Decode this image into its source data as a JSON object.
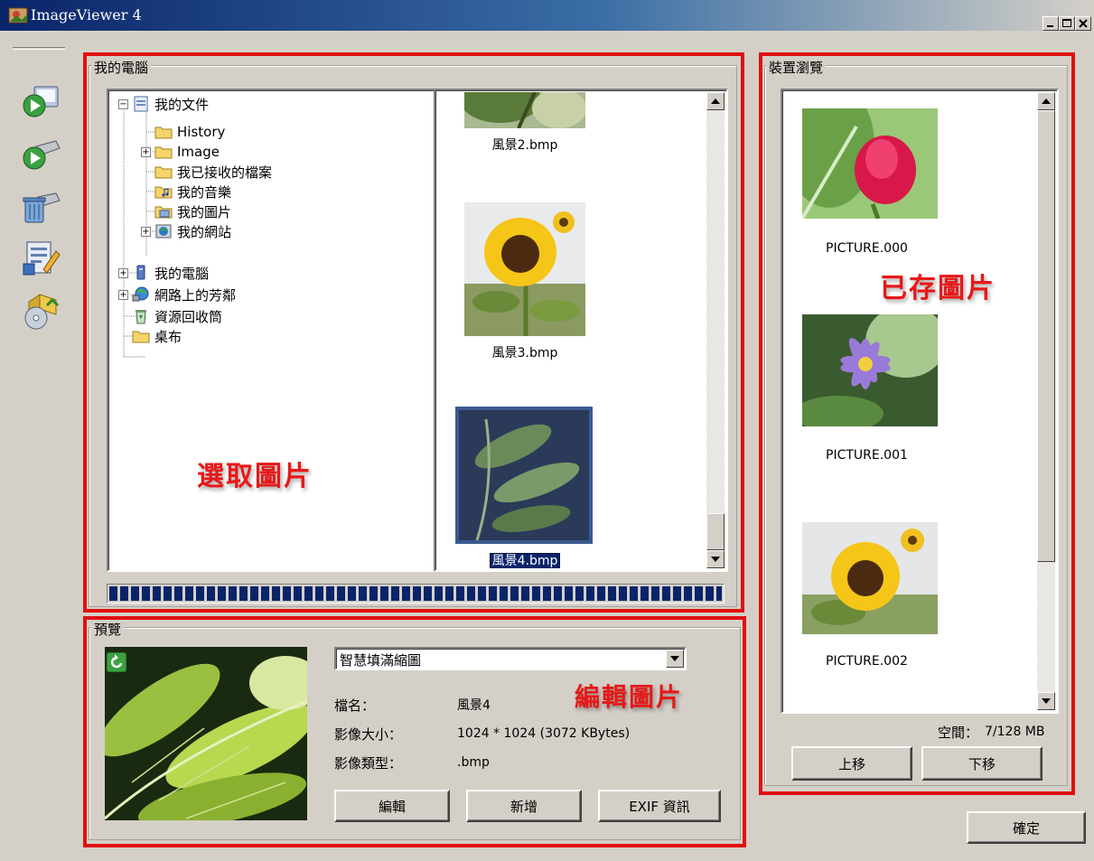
{
  "window": {
    "title": "ImageViewer 4",
    "controls": [
      "minimize",
      "maximize",
      "close"
    ]
  },
  "toolbar": {
    "icons": [
      "play-slideshow-icon",
      "send-device-icon",
      "device-delete-icon",
      "edit-document-icon",
      "install-disc-icon"
    ]
  },
  "my_computer": {
    "label": "我的電腦",
    "tree": [
      {
        "label": "我的文件",
        "expander": "−",
        "icon": "documents-icon"
      },
      {
        "label": "History",
        "expander": "",
        "icon": "folder-icon"
      },
      {
        "label": "Image",
        "expander": "+",
        "icon": "folder-icon"
      },
      {
        "label": "我已接收的檔案",
        "expander": "",
        "icon": "folder-icon"
      },
      {
        "label": "我的音樂",
        "expander": "",
        "icon": "music-folder-icon"
      },
      {
        "label": "我的圖片",
        "expander": "",
        "icon": "pictures-folder-icon"
      },
      {
        "label": "我的網站",
        "expander": "+",
        "icon": "web-folder-icon"
      },
      {
        "label": "我的電腦",
        "expander": "+",
        "icon": "computer-icon"
      },
      {
        "label": "網路上的芳鄰",
        "expander": "+",
        "icon": "network-icon"
      },
      {
        "label": "資源回收筒",
        "expander": "",
        "icon": "recycle-bin-icon"
      },
      {
        "label": "桌布",
        "expander": "",
        "icon": "folder-icon"
      }
    ],
    "thumbnails": [
      {
        "name": "風景2.bmp",
        "selected": false
      },
      {
        "name": "風景3.bmp",
        "selected": false
      },
      {
        "name": "風景4.bmp",
        "selected": true
      }
    ],
    "annotation": "選取圖片"
  },
  "preview": {
    "label": "預覽",
    "mode_select": "智慧填滿縮圖",
    "filename_label": "檔名：",
    "filename": "風景4",
    "size_label": "影像大小：",
    "size": "1024 * 1024 (3072 KBytes)",
    "type_label": "影像類型：",
    "type": ".bmp",
    "buttons": {
      "edit": "編輯",
      "add": "新增",
      "exif": "EXIF 資訊"
    },
    "annotation": "編輯圖片"
  },
  "device": {
    "label": "裝置瀏覽",
    "pictures": [
      "PICTURE.000",
      "PICTURE.001",
      "PICTURE.002"
    ],
    "annotation": "已存圖片",
    "space_label": "空間：",
    "space_value": "7/128 MB",
    "buttons": {
      "up": "上移",
      "down": "下移"
    }
  },
  "ok_button": "確定",
  "colors": {
    "annotation_red": "#e01010",
    "titlebar_blue": "#0a246a",
    "progress_blue": "#0a246a",
    "face": "#d4d0c8"
  }
}
